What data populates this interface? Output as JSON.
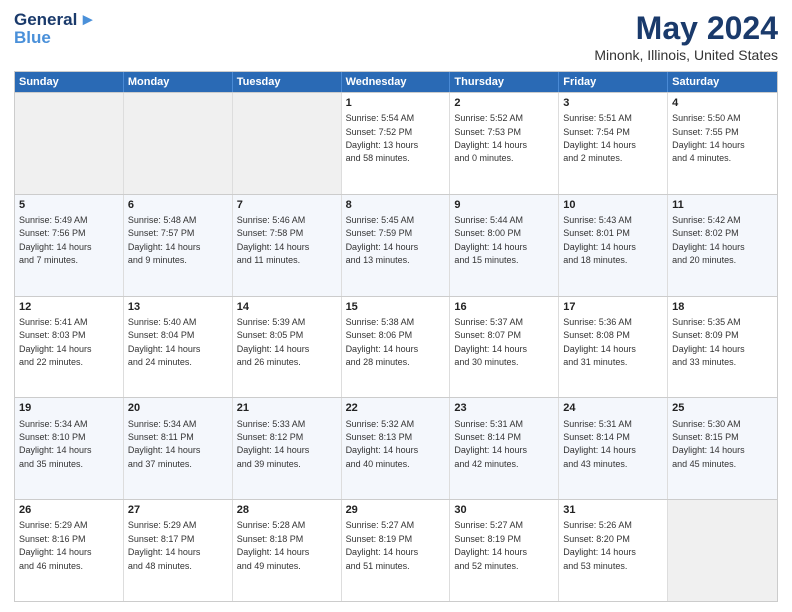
{
  "logo": {
    "line1": "General",
    "line2": "Blue"
  },
  "title": "May 2024",
  "subtitle": "Minonk, Illinois, United States",
  "weekdays": [
    "Sunday",
    "Monday",
    "Tuesday",
    "Wednesday",
    "Thursday",
    "Friday",
    "Saturday"
  ],
  "rows": [
    [
      {
        "day": "",
        "info": ""
      },
      {
        "day": "",
        "info": ""
      },
      {
        "day": "",
        "info": ""
      },
      {
        "day": "1",
        "info": "Sunrise: 5:54 AM\nSunset: 7:52 PM\nDaylight: 13 hours\nand 58 minutes."
      },
      {
        "day": "2",
        "info": "Sunrise: 5:52 AM\nSunset: 7:53 PM\nDaylight: 14 hours\nand 0 minutes."
      },
      {
        "day": "3",
        "info": "Sunrise: 5:51 AM\nSunset: 7:54 PM\nDaylight: 14 hours\nand 2 minutes."
      },
      {
        "day": "4",
        "info": "Sunrise: 5:50 AM\nSunset: 7:55 PM\nDaylight: 14 hours\nand 4 minutes."
      }
    ],
    [
      {
        "day": "5",
        "info": "Sunrise: 5:49 AM\nSunset: 7:56 PM\nDaylight: 14 hours\nand 7 minutes."
      },
      {
        "day": "6",
        "info": "Sunrise: 5:48 AM\nSunset: 7:57 PM\nDaylight: 14 hours\nand 9 minutes."
      },
      {
        "day": "7",
        "info": "Sunrise: 5:46 AM\nSunset: 7:58 PM\nDaylight: 14 hours\nand 11 minutes."
      },
      {
        "day": "8",
        "info": "Sunrise: 5:45 AM\nSunset: 7:59 PM\nDaylight: 14 hours\nand 13 minutes."
      },
      {
        "day": "9",
        "info": "Sunrise: 5:44 AM\nSunset: 8:00 PM\nDaylight: 14 hours\nand 15 minutes."
      },
      {
        "day": "10",
        "info": "Sunrise: 5:43 AM\nSunset: 8:01 PM\nDaylight: 14 hours\nand 18 minutes."
      },
      {
        "day": "11",
        "info": "Sunrise: 5:42 AM\nSunset: 8:02 PM\nDaylight: 14 hours\nand 20 minutes."
      }
    ],
    [
      {
        "day": "12",
        "info": "Sunrise: 5:41 AM\nSunset: 8:03 PM\nDaylight: 14 hours\nand 22 minutes."
      },
      {
        "day": "13",
        "info": "Sunrise: 5:40 AM\nSunset: 8:04 PM\nDaylight: 14 hours\nand 24 minutes."
      },
      {
        "day": "14",
        "info": "Sunrise: 5:39 AM\nSunset: 8:05 PM\nDaylight: 14 hours\nand 26 minutes."
      },
      {
        "day": "15",
        "info": "Sunrise: 5:38 AM\nSunset: 8:06 PM\nDaylight: 14 hours\nand 28 minutes."
      },
      {
        "day": "16",
        "info": "Sunrise: 5:37 AM\nSunset: 8:07 PM\nDaylight: 14 hours\nand 30 minutes."
      },
      {
        "day": "17",
        "info": "Sunrise: 5:36 AM\nSunset: 8:08 PM\nDaylight: 14 hours\nand 31 minutes."
      },
      {
        "day": "18",
        "info": "Sunrise: 5:35 AM\nSunset: 8:09 PM\nDaylight: 14 hours\nand 33 minutes."
      }
    ],
    [
      {
        "day": "19",
        "info": "Sunrise: 5:34 AM\nSunset: 8:10 PM\nDaylight: 14 hours\nand 35 minutes."
      },
      {
        "day": "20",
        "info": "Sunrise: 5:34 AM\nSunset: 8:11 PM\nDaylight: 14 hours\nand 37 minutes."
      },
      {
        "day": "21",
        "info": "Sunrise: 5:33 AM\nSunset: 8:12 PM\nDaylight: 14 hours\nand 39 minutes."
      },
      {
        "day": "22",
        "info": "Sunrise: 5:32 AM\nSunset: 8:13 PM\nDaylight: 14 hours\nand 40 minutes."
      },
      {
        "day": "23",
        "info": "Sunrise: 5:31 AM\nSunset: 8:14 PM\nDaylight: 14 hours\nand 42 minutes."
      },
      {
        "day": "24",
        "info": "Sunrise: 5:31 AM\nSunset: 8:14 PM\nDaylight: 14 hours\nand 43 minutes."
      },
      {
        "day": "25",
        "info": "Sunrise: 5:30 AM\nSunset: 8:15 PM\nDaylight: 14 hours\nand 45 minutes."
      }
    ],
    [
      {
        "day": "26",
        "info": "Sunrise: 5:29 AM\nSunset: 8:16 PM\nDaylight: 14 hours\nand 46 minutes."
      },
      {
        "day": "27",
        "info": "Sunrise: 5:29 AM\nSunset: 8:17 PM\nDaylight: 14 hours\nand 48 minutes."
      },
      {
        "day": "28",
        "info": "Sunrise: 5:28 AM\nSunset: 8:18 PM\nDaylight: 14 hours\nand 49 minutes."
      },
      {
        "day": "29",
        "info": "Sunrise: 5:27 AM\nSunset: 8:19 PM\nDaylight: 14 hours\nand 51 minutes."
      },
      {
        "day": "30",
        "info": "Sunrise: 5:27 AM\nSunset: 8:19 PM\nDaylight: 14 hours\nand 52 minutes."
      },
      {
        "day": "31",
        "info": "Sunrise: 5:26 AM\nSunset: 8:20 PM\nDaylight: 14 hours\nand 53 minutes."
      },
      {
        "day": "",
        "info": ""
      }
    ]
  ]
}
